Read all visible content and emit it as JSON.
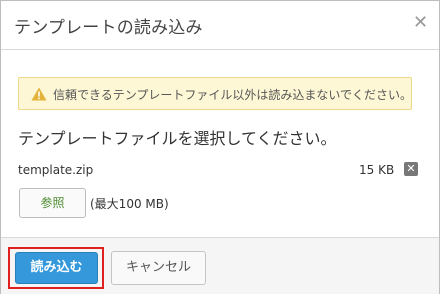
{
  "dialog": {
    "title": "テンプレートの読み込み",
    "close_icon": "close-icon"
  },
  "warning": {
    "icon": "warning-icon",
    "text": "信頼できるテンプレートファイル以外は読み込まないでください。",
    "colors": {
      "background": "#fdf7d6",
      "border": "#f0d889",
      "icon": "#e3b33a"
    }
  },
  "upload": {
    "instruction": "テンプレートファイルを選択してください。",
    "file_name": "template.zip",
    "file_size": "15 KB",
    "remove_icon": "remove-file-icon",
    "browse_label": "参照",
    "size_limit": "(最大100 MB)"
  },
  "footer": {
    "import_label": "読み込む",
    "cancel_label": "キャンセル",
    "colors": {
      "primary": "#3498db",
      "highlight": "#e02020"
    }
  }
}
